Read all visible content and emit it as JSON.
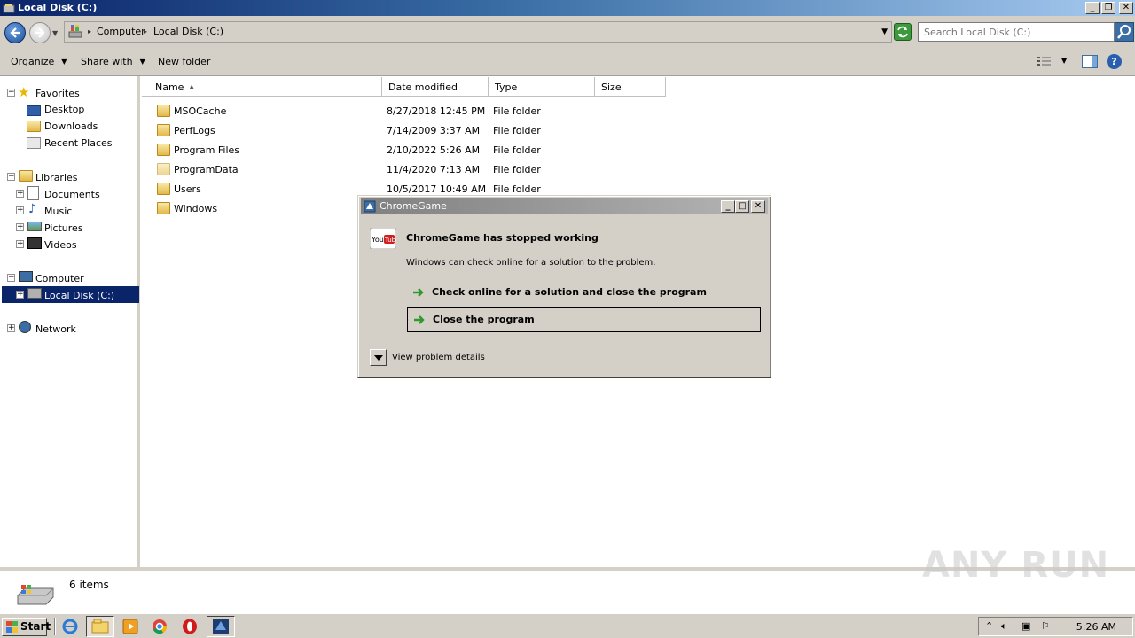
{
  "window": {
    "title": "Local Disk (C:)"
  },
  "address": {
    "crumbs": [
      "Computer",
      "Local Disk (C:)"
    ],
    "search_placeholder": "Search Local Disk (C:)"
  },
  "toolbar": {
    "organize": "Organize",
    "share_with": "Share with",
    "new_folder": "New folder"
  },
  "nav": {
    "favorites": "Favorites",
    "desktop": "Desktop",
    "downloads": "Downloads",
    "recent": "Recent Places",
    "libraries": "Libraries",
    "documents": "Documents",
    "music": "Music",
    "pictures": "Pictures",
    "videos": "Videos",
    "computer": "Computer",
    "local_disk": "Local Disk (C:)",
    "network": "Network"
  },
  "columns": {
    "name": "Name",
    "date": "Date modified",
    "type": "Type",
    "size": "Size"
  },
  "files": [
    {
      "name": "MSOCache",
      "date": "8/27/2018 12:45 PM",
      "type": "File folder"
    },
    {
      "name": "PerfLogs",
      "date": "7/14/2009 3:37 AM",
      "type": "File folder"
    },
    {
      "name": "Program Files",
      "date": "2/10/2022 5:26 AM",
      "type": "File folder"
    },
    {
      "name": "ProgramData",
      "date": "11/4/2020 7:13 AM",
      "type": "File folder"
    },
    {
      "name": "Users",
      "date": "10/5/2017 10:49 AM",
      "type": "File folder"
    },
    {
      "name": "Windows",
      "date": "",
      "type": ""
    }
  ],
  "details": {
    "count": "6 items"
  },
  "dialog": {
    "title": "ChromeGame",
    "heading": "ChromeGame has stopped working",
    "subtext": "Windows can check online for a solution to the problem.",
    "option1": "Check online for a solution and close the program",
    "option2": "Close the program",
    "details": "View problem details"
  },
  "taskbar": {
    "start": "Start",
    "clock": "5:26 AM"
  },
  "watermark": "ANY RUN",
  "colors": {
    "selection": "#0a246a",
    "titlebar": "#0a246a",
    "face": "#d4d0c8"
  }
}
